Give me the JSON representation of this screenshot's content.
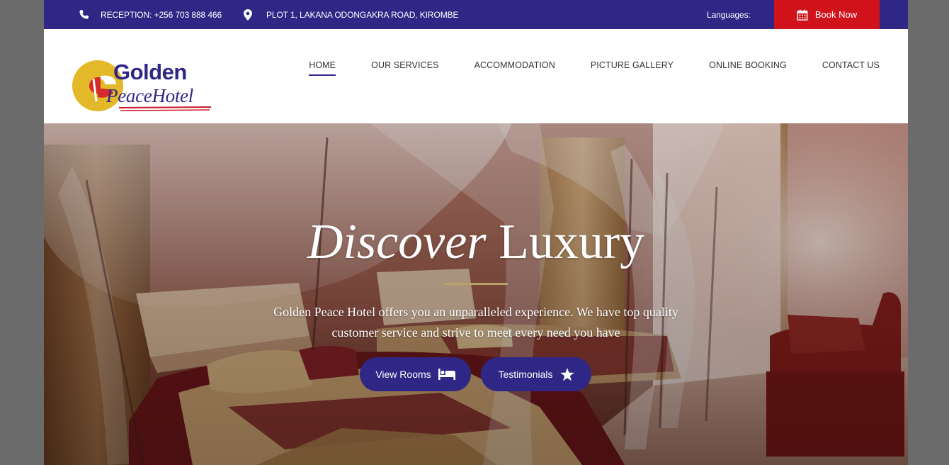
{
  "topbar": {
    "reception": "RECEPTION: +256 703 888 466",
    "address": "PLOT 1, LAKANA ODONGAKRA ROAD, KIROMBE",
    "languages_label": "Languages:",
    "book_now": "Book Now",
    "phone_icon": "phone-icon",
    "map_icon": "map-marker-icon",
    "calendar_icon": "calendar-icon"
  },
  "logo": {
    "word1": "Golden",
    "word2": "PeaceHotel"
  },
  "nav": {
    "items": [
      {
        "label": "HOME",
        "active": true
      },
      {
        "label": "OUR SERVICES"
      },
      {
        "label": "ACCOMMODATION"
      },
      {
        "label": "PICTURE GALLERY"
      },
      {
        "label": "ONLINE BOOKING"
      },
      {
        "label": "CONTACT US"
      }
    ]
  },
  "hero": {
    "title_italic": "Discover",
    "title_rest": " Luxury",
    "text": "Golden Peace Hotel offers you an unparalleled experience. We have top quality customer service and strive to meet every need you have",
    "view_rooms": "View Rooms",
    "testimonials": "Testimonials",
    "bed_icon": "bed-icon",
    "star_icon": "star-icon"
  },
  "colors": {
    "brand_purple": "#2f2785",
    "book_red": "#d0121b",
    "divider_gold": "#b7a36a"
  }
}
